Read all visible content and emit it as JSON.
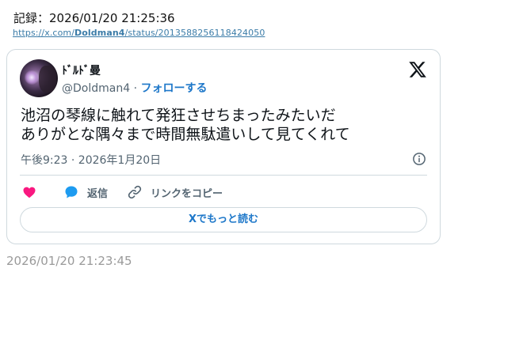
{
  "record": {
    "label": "記録：2026/01/20 21:25:36"
  },
  "source": {
    "prefix": "https://x.com/",
    "user": "Doldman4",
    "suffix": "/status/2013588256118424050"
  },
  "tweet": {
    "display_name": "ﾄﾞﾙﾄﾞ曼",
    "handle": "@Doldman4",
    "separator": " · ",
    "follow_label": "フォローする",
    "text": "池沼の琴線に触れて発狂させちまったみたいだ\nありがとな隅々まで時間無駄遣いして見てくれて",
    "timestamp": "午後9:23 · 2026年1月20日",
    "reply_label": "返信",
    "copy_link_label": "リンクをコピー",
    "read_more_label": "Xでもっと読む"
  },
  "saved_time": "2026/01/20 21:23:45",
  "icons": {
    "logo": "x-logo-icon",
    "info": "info-icon",
    "like": "heart-icon",
    "reply": "speech-bubble-icon",
    "copy": "link-icon"
  },
  "colors": {
    "accent": "#1d77c9",
    "heart": "#f91880",
    "reply": "#1d9bf0",
    "muted": "#536471",
    "border": "#cfd9de"
  }
}
